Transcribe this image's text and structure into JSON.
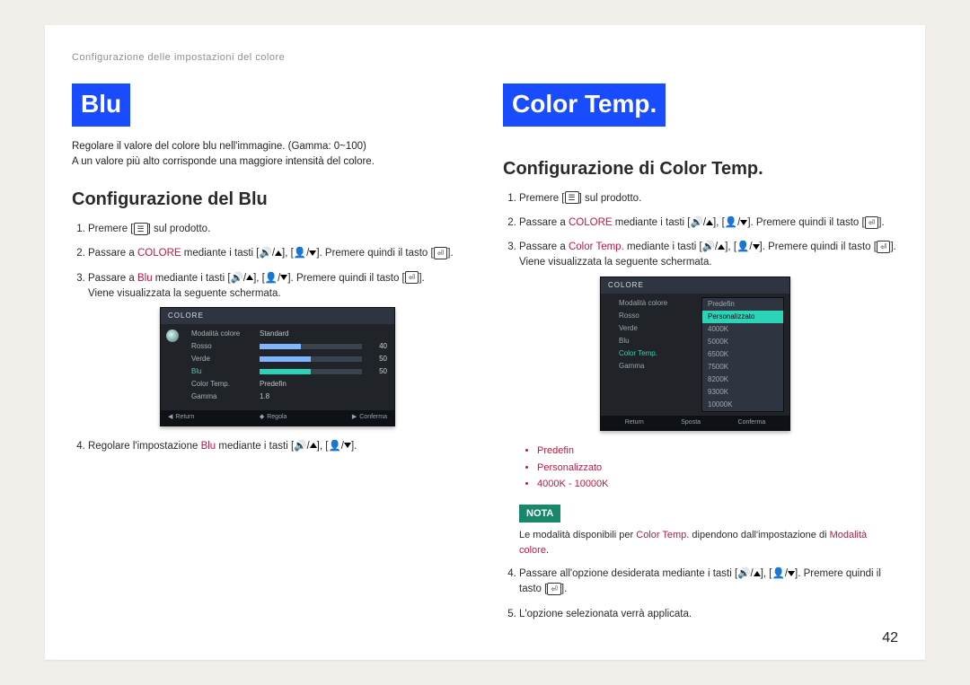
{
  "header": "Configurazione delle impostazioni del colore",
  "page_number": "42",
  "left": {
    "title": "Blu",
    "desc1": "Regolare il valore del colore blu nell'immagine. (Gamma: 0~100)",
    "desc2": "A un valore più alto corrisponde una maggiore intensità del colore.",
    "subheading": "Configurazione del Blu",
    "step1a": "Premere [",
    "step1b": "] sul prodotto.",
    "step2a": "Passare a ",
    "step2_colore": "COLORE",
    "step2b": " mediante i tasti [",
    "step2c": "]. Premere quindi il tasto [",
    "step2d": "].",
    "step3a": "Passare a ",
    "step3_blu": "Blu",
    "step3b": " mediante i tasti [",
    "step3c": "]. Premere quindi il tasto [",
    "step3d": "].",
    "step3e": "Viene visualizzata la seguente schermata.",
    "step4a": "Regolare l'impostazione ",
    "step4_blu": "Blu",
    "step4b": " mediante i tasti [",
    "step4c": "].",
    "osd": {
      "title": "COLORE",
      "rows": {
        "mode_label": "Modalità colore",
        "mode_val": "Standard",
        "rosso_label": "Rosso",
        "rosso_val": "40",
        "verde_label": "Verde",
        "verde_val": "50",
        "blu_label": "Blu",
        "blu_val": "50",
        "ct_label": "Color Temp.",
        "ct_val": "Predefin",
        "gamma_label": "Gamma",
        "gamma_val": "1.8"
      },
      "footer": {
        "return": "Return",
        "regola": "Regola",
        "conferma": "Conferma"
      }
    }
  },
  "right": {
    "title": "Color Temp.",
    "subheading": "Configurazione di Color Temp.",
    "step1a": "Premere [",
    "step1b": "] sul prodotto.",
    "step2a": "Passare a ",
    "step2_colore": "COLORE",
    "step2b": " mediante i tasti [",
    "step2c": "]. Premere quindi il tasto [",
    "step2d": "].",
    "step3a": "Passare a ",
    "step3_ct": "Color Temp.",
    "step3b": " mediante i tasti [",
    "step3c": "]. Premere quindi il tasto [",
    "step3d": "].",
    "step3e": "Viene visualizzata la seguente schermata.",
    "bullets": {
      "b1": "Predefin",
      "b2": "Personalizzato",
      "b3": "4000K - 10000K"
    },
    "nota_label": "NOTA",
    "nota_a": "Le modalità disponibili per ",
    "nota_ct": "Color Temp.",
    "nota_b": " dipendono dall'impostazione di ",
    "nota_mc": "Modalità colore",
    "nota_c": ".",
    "step4a": "Passare all'opzione desiderata mediante i tasti [",
    "step4b": "]. Premere quindi il tasto [",
    "step4c": "].",
    "step5": "L'opzione selezionata verrà applicata.",
    "osd": {
      "title": "COLORE",
      "labels": {
        "mode": "Modalità colore",
        "rosso": "Rosso",
        "verde": "Verde",
        "blu": "Blu",
        "ct": "Color Temp.",
        "gamma": "Gamma"
      },
      "opts": {
        "o0": "Predefin",
        "o1": "Personalizzato",
        "o2": "4000K",
        "o3": "5000K",
        "o4": "6500K",
        "o5": "7500K",
        "o6": "8200K",
        "o7": "9300K",
        "o8": "10000K"
      },
      "footer": {
        "return": "Return",
        "sposta": "Sposta",
        "conferma": "Conferma"
      }
    }
  }
}
